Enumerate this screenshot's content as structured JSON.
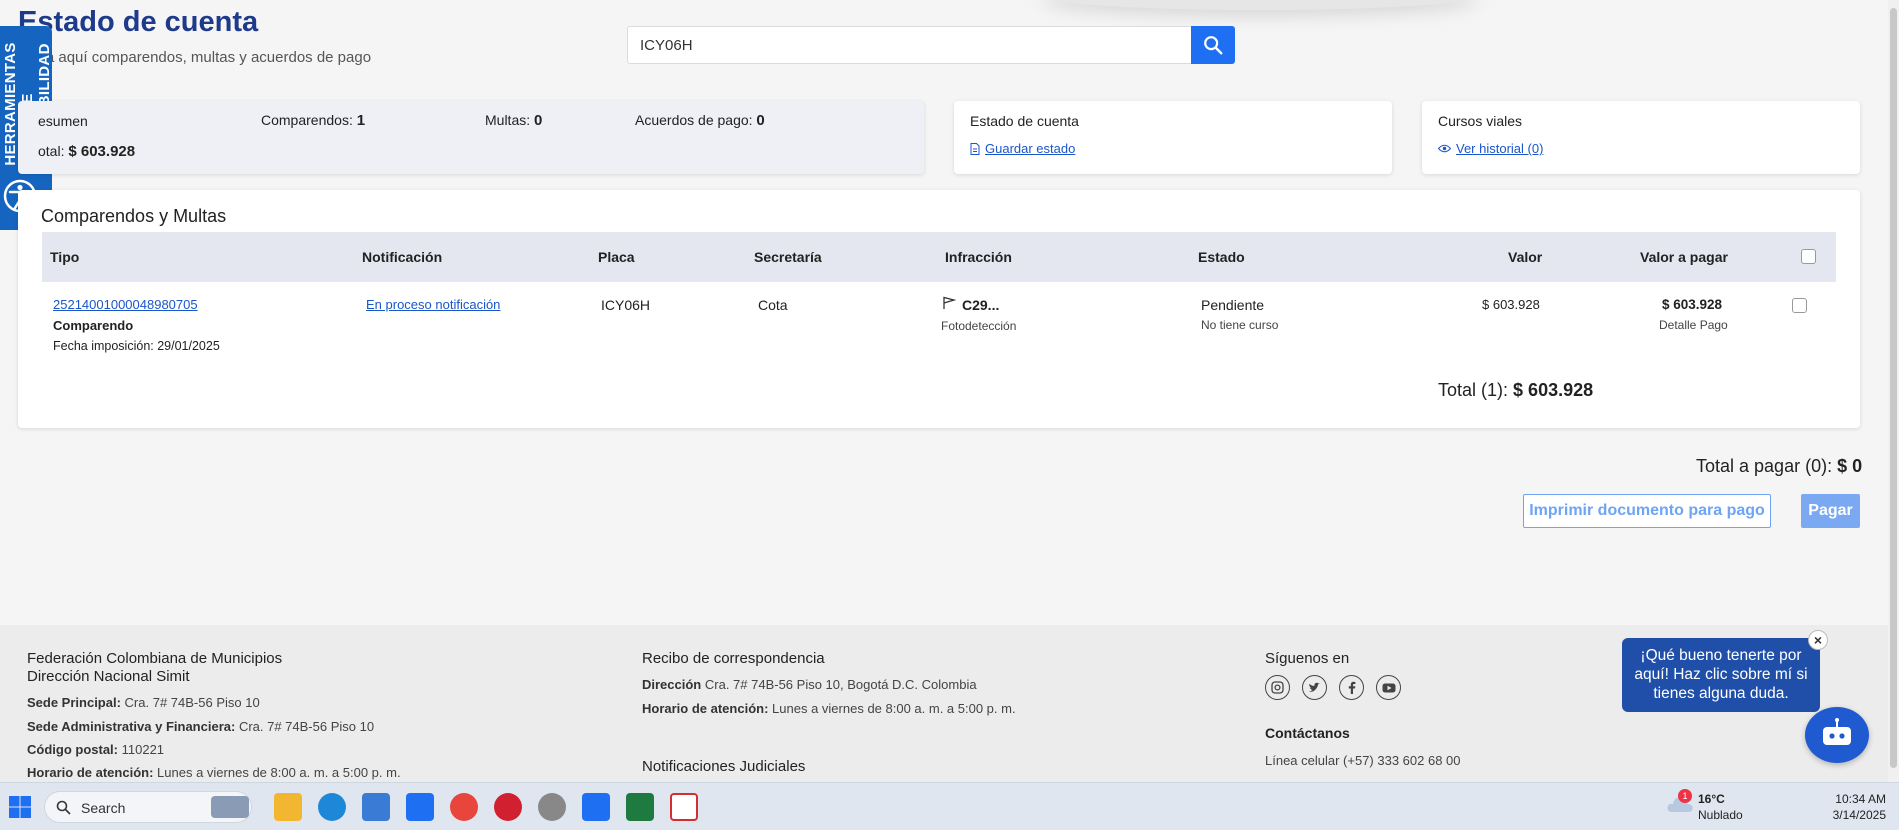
{
  "header": {
    "title": "Estado de cuenta",
    "subtitle": "ulta aquí comparendos, multas y acuerdos de pago",
    "search_value": "ICY06H"
  },
  "accessibility": {
    "label": "HERRAMIENTAS DE ACCESIBILIDAD"
  },
  "summary": {
    "label": "esumen",
    "total_label": "otal:",
    "total_value": "$ 603.928",
    "comparendos_label": "Comparendos:",
    "comparendos_value": "1",
    "multas_label": "Multas:",
    "multas_value": "0",
    "acuerdos_label": "Acuerdos de pago:",
    "acuerdos_value": "0"
  },
  "state_card": {
    "title": "Estado de cuenta",
    "link": "Guardar estado"
  },
  "courses_card": {
    "title": "Cursos viales",
    "link": "Ver historial (0)"
  },
  "table": {
    "title": "Comparendos y Multas",
    "headers": {
      "tipo": "Tipo",
      "notificacion": "Notificación",
      "placa": "Placa",
      "secretaria": "Secretaría",
      "infraccion": "Infracción",
      "estado": "Estado",
      "valor": "Valor",
      "valor_pagar": "Valor a pagar"
    },
    "rows": [
      {
        "number": "25214001000048980705",
        "type": "Comparendo",
        "date": "Fecha imposición: 29/01/2025",
        "notification": "En proceso notificación",
        "plate": "ICY06H",
        "secretaria": "Cota",
        "infraction_code": "C29...",
        "infraction_source": "Fotodetección",
        "status": "Pendiente",
        "status_note": "No tiene curso",
        "value": "$ 603.928",
        "value_to_pay": "$ 603.928",
        "detail": "Detalle Pago"
      }
    ],
    "total_label": "Total (1):",
    "total_value": "$ 603.928"
  },
  "payment": {
    "total_label": "Total a pagar (0):",
    "total_value": "$ 0",
    "print_button": "Imprimir documento para pago",
    "pay_button": "Pagar"
  },
  "footer": {
    "org_line1": "Federación Colombiana de Municipios",
    "org_line2": "Dirección Nacional Simit",
    "sede_principal_label": "Sede Principal:",
    "sede_principal": "Cra. 7# 74B-56 Piso 10",
    "sede_admin_label": "Sede Administrativa y Financiera:",
    "sede_admin": "Cra. 7# 74B-56 Piso 10",
    "codigo_label": "Código postal:",
    "codigo": "110221",
    "horario_label": "Horario de atención:",
    "horario": "Lunes a viernes de 8:00 a. m. a 5:00 p. m.",
    "recibo_title": "Recibo de correspondencia",
    "direccion_label": "Dirección",
    "direccion": "Cra. 7# 74B-56 Piso 10, Bogotá D.C. Colombia",
    "recibo_horario_label": "Horario de atención:",
    "recibo_horario": "Lunes a viernes de 8:00 a. m. a 5:00 p. m.",
    "notificaciones_title": "Notificaciones Judiciales",
    "siguenos": "Síguenos en",
    "contactanos": "Contáctanos",
    "celular": "Línea celular (+57) 333 602 68 00"
  },
  "chat": {
    "message": "¡Qué bueno tenerte por aquí! Haz clic sobre mí si tienes alguna duda.",
    "close": "×"
  },
  "taskbar": {
    "search_label": "Search",
    "weather_temp": "16°C",
    "weather_desc": "Nublado",
    "weather_badge": "1",
    "time": "10:34 AM",
    "date": "3/14/2025"
  },
  "colors": {
    "primary": "#1f6ff2",
    "title": "#1e3a8a",
    "link": "#1a56c9",
    "chat": "#1f4fa8"
  }
}
